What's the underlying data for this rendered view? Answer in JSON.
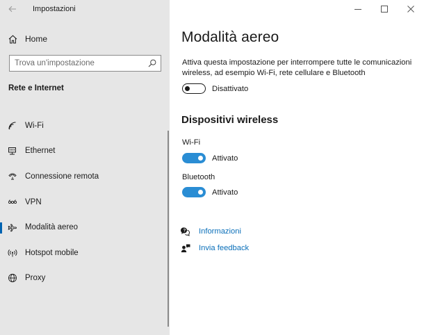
{
  "window": {
    "title": "Impostazioni",
    "controls": {
      "minimize": "minimize-icon",
      "maximize": "maximize-icon",
      "close": "close-icon"
    }
  },
  "sidebar": {
    "home_label": "Home",
    "search_placeholder": "Trova un'impostazione",
    "section_title": "Rete e Internet",
    "items": [
      {
        "label": "Wi-Fi",
        "icon": "wifi-icon",
        "active": false
      },
      {
        "label": "Ethernet",
        "icon": "ethernet-icon",
        "active": false
      },
      {
        "label": "Connessione remota",
        "icon": "dialup-icon",
        "active": false
      },
      {
        "label": "VPN",
        "icon": "vpn-icon",
        "active": false
      },
      {
        "label": "Modalità aereo",
        "icon": "airplane-icon",
        "active": true
      },
      {
        "label": "Hotspot mobile",
        "icon": "hotspot-icon",
        "active": false
      },
      {
        "label": "Proxy",
        "icon": "globe-icon",
        "active": false
      }
    ]
  },
  "main": {
    "title": "Modalità aereo",
    "description": "Attiva questa impostazione per interrompere tutte le comunicazioni wireless, ad esempio Wi-Fi, rete cellulare e Bluetooth",
    "airplane_toggle": {
      "state": "off",
      "label": "Disattivato"
    },
    "wireless_heading": "Dispositivi wireless",
    "devices": [
      {
        "name": "Wi-Fi",
        "state": "on",
        "state_label": "Attivato"
      },
      {
        "name": "Bluetooth",
        "state": "on",
        "state_label": "Attivato"
      }
    ],
    "links": [
      {
        "label": "Informazioni",
        "icon": "help-chat-icon"
      },
      {
        "label": "Invia feedback",
        "icon": "feedback-icon"
      }
    ]
  },
  "colors": {
    "accent": "#0063b1",
    "toggle_on": "#2a8dd4",
    "link": "#0a6fb9",
    "sidebar_bg": "#e6e6e6"
  }
}
